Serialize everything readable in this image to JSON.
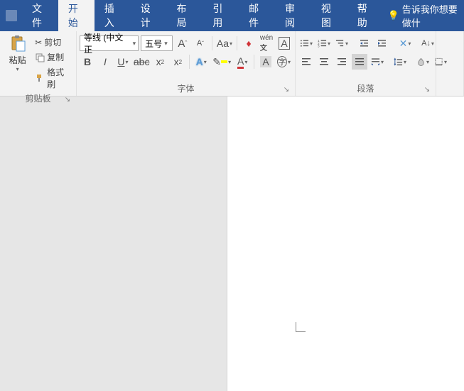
{
  "tabs": {
    "file": "文件",
    "home": "开始",
    "insert": "插入",
    "design": "设计",
    "layout": "布局",
    "references": "引用",
    "mail": "邮件",
    "review": "审阅",
    "view": "视图",
    "help": "帮助"
  },
  "tellme": "告诉我你想要做什",
  "clipboard": {
    "paste": "粘贴",
    "cut": "剪切",
    "copy": "复制",
    "formatpainter": "格式刷",
    "label": "剪贴板"
  },
  "font": {
    "family": "等线 (中文正",
    "size": "五号",
    "label": "字体"
  },
  "paragraph": {
    "label": "段落"
  }
}
